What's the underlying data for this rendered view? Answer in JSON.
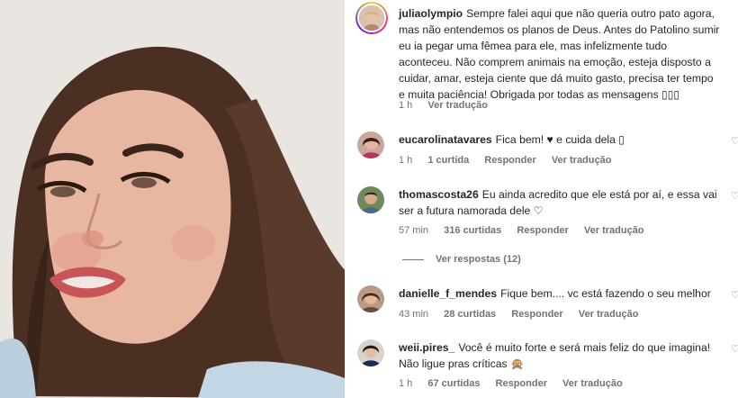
{
  "post": {
    "author": "juliaolympio",
    "caption": "Sempre falei aqui que não queria outro pato agora, mas não entendemos os planos de Deus. Antes do Patolino sumir eu ia pegar uma fêmea para ele, mas infelizmente tudo aconteceu. Não comprem animais na emoção, esteja disposto a cuidar, amar, esteja ciente que dá muito gasto, precisa ter tempo e muita paciência! Obrigada por todas as mensagens ▯▯▯",
    "time": "1 h",
    "translate": "Ver tradução"
  },
  "comments": [
    {
      "user": "eucarolinatavares",
      "text": "Fica bem! ♥ e cuida dela ▯",
      "time": "1 h",
      "likes": "1 curtida",
      "reply": "Responder",
      "translate": "Ver tradução"
    },
    {
      "user": "thomascosta26",
      "text": "Eu ainda acredito que ele está por aí, e essa vai ser a futura namorada dele ♡",
      "time": "57 min",
      "likes": "316 curtidas",
      "reply": "Responder",
      "translate": "Ver tradução",
      "view_replies": "Ver respostas (12)"
    },
    {
      "user": "danielle_f_mendes",
      "text": "Fique bem.... vc está fazendo o seu melhor",
      "time": "43 min",
      "likes": "28 curtidas",
      "reply": "Responder",
      "translate": "Ver tradução"
    },
    {
      "user": "weii.pires_",
      "text": "Você é muito forte e será mais feliz do que imagina! Não ligue pras críticas 🙊",
      "time": "1 h",
      "likes": "67 curtidas",
      "reply": "Responder",
      "translate": "Ver tradução"
    }
  ],
  "icons": {
    "like": "heart-outline-icon"
  },
  "colors": {
    "text": "#262626",
    "secondary": "#737373",
    "story_ring": [
      "#f9ce34",
      "#ee2a7b",
      "#6228d7"
    ]
  }
}
